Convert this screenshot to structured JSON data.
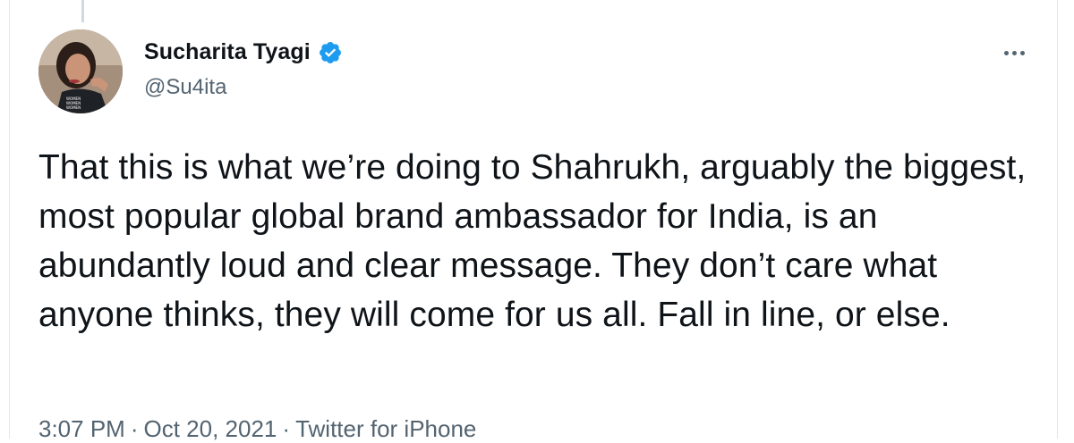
{
  "tweet": {
    "author": {
      "display_name": "Sucharita Tyagi",
      "handle": "@Su4ita",
      "verified": true,
      "avatar_shirt_text": "WOMEN WOMEN WOMEN WOMEN"
    },
    "text": "That this is what we’re doing to Shahrukh, arguably the biggest, most popular global brand ambassador for India, is an abundantly loud and clear message. They don’t care what anyone thinks, they will come for us all. Fall in line, or else.",
    "time": "3:07 PM",
    "date": "Oct 20, 2021",
    "source": "Twitter for iPhone",
    "separator": "·"
  },
  "icons": {
    "verified": "verified-badge-icon",
    "more": "more-options-icon"
  },
  "colors": {
    "verified_blue": "#1d9bf0",
    "text_primary": "#0f1419",
    "text_secondary": "#536471"
  }
}
